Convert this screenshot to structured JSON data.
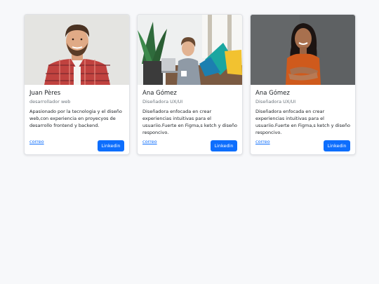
{
  "cards": [
    {
      "name": "Juan Pères",
      "role": "desarrollador web",
      "description": "Apasionado por la tecnologia y el diseño web,con experiencia en proyecyos de desarrollo frontend y backend.",
      "link_label": "correo",
      "button_label": "Linkedin"
    },
    {
      "name": "Ana Gómez",
      "role": "Diseñadora UX/UI",
      "description": "Diseñadora enfocada en crear experiencias intuitivas para el usuariio.Fuerte en Figma,s ketch y diseño responcivo.",
      "link_label": "correo",
      "button_label": "Linkedin"
    },
    {
      "name": "Ana Gómez",
      "role": "Diseñadora UX/UI",
      "description": "Diseñadora enfocada en crear experiencias intuitivas para el usuariio.Fuerte en Figma,s ketch y diseño responcivo.",
      "link_label": "correo",
      "button_label": "Linkedin"
    }
  ],
  "colors": {
    "accent": "#0d6efd",
    "page_background": "#f7f8fa"
  }
}
